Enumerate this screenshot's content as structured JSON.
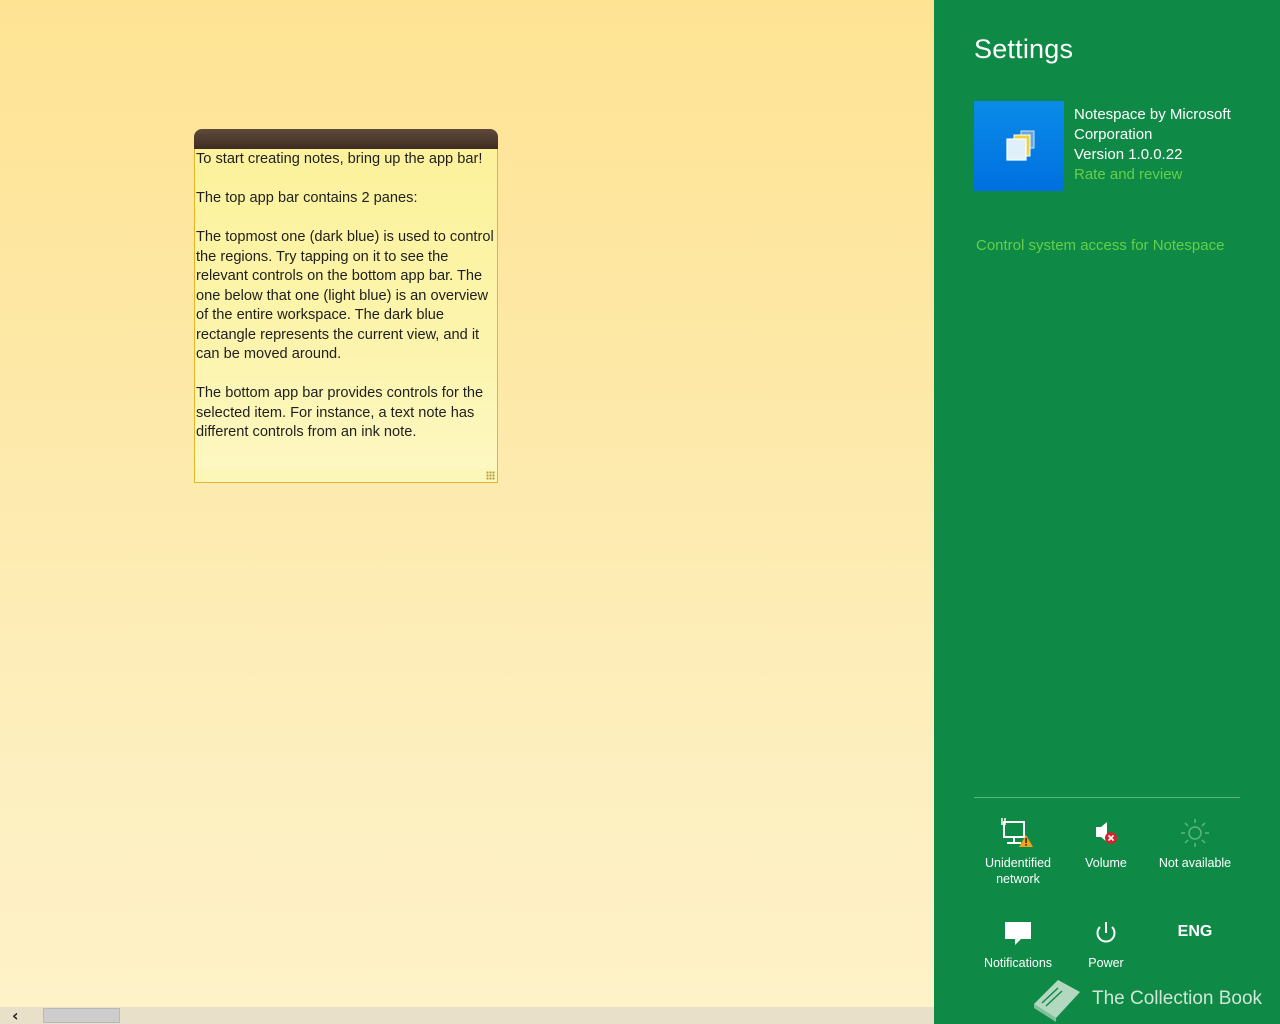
{
  "note": {
    "paragraphs": [
      "To start creating notes, bring up the app bar!",
      "The top app bar contains 2 panes:",
      "The topmost one (dark blue) is used to control the regions. Try tapping on it to see the relevant controls on the bottom app bar. The one below that one (light blue) is an overview of the entire workspace. The dark blue rectangle represents the current view, and it can be moved around.",
      "The bottom app bar provides controls for the selected item. For instance, a text note has different controls from an ink note."
    ]
  },
  "scrollbar": {
    "left_arrow_icon": "chevron-left-icon",
    "left_arrow_glyph": "‹"
  },
  "settings": {
    "title": "Settings",
    "app": {
      "tile_icon": "notespace-app-icon",
      "name_line1": "Notespace by Microsoft",
      "name_line2": "Corporation",
      "version": "Version 1.0.0.22",
      "rate_link": "Rate and review"
    },
    "permissions_link": "Control system access for Notespace",
    "tray": [
      {
        "icon": "network-warning-icon",
        "label_line1": "Unidentified",
        "label_line2": "network"
      },
      {
        "icon": "volume-muted-icon",
        "label_line1": "Volume",
        "label_line2": ""
      },
      {
        "icon": "brightness-icon",
        "label_line1": "Not available",
        "label_line2": ""
      },
      {
        "icon": "notifications-icon",
        "label_line1": "Notifications",
        "label_line2": ""
      },
      {
        "icon": "power-icon",
        "label_line1": "Power",
        "label_line2": ""
      },
      {
        "icon": "keyboard-language",
        "label_line1": "ENG",
        "label_line2": ""
      }
    ]
  },
  "watermark": {
    "text": "The Collection Book"
  },
  "colors": {
    "charm_background": "#0f8a46",
    "link": "#64d04a",
    "note_header": "#4a3829",
    "note_background": "#fcf4ac",
    "workspace_background": "#fde8a6",
    "app_tile": "#0a84e6"
  }
}
